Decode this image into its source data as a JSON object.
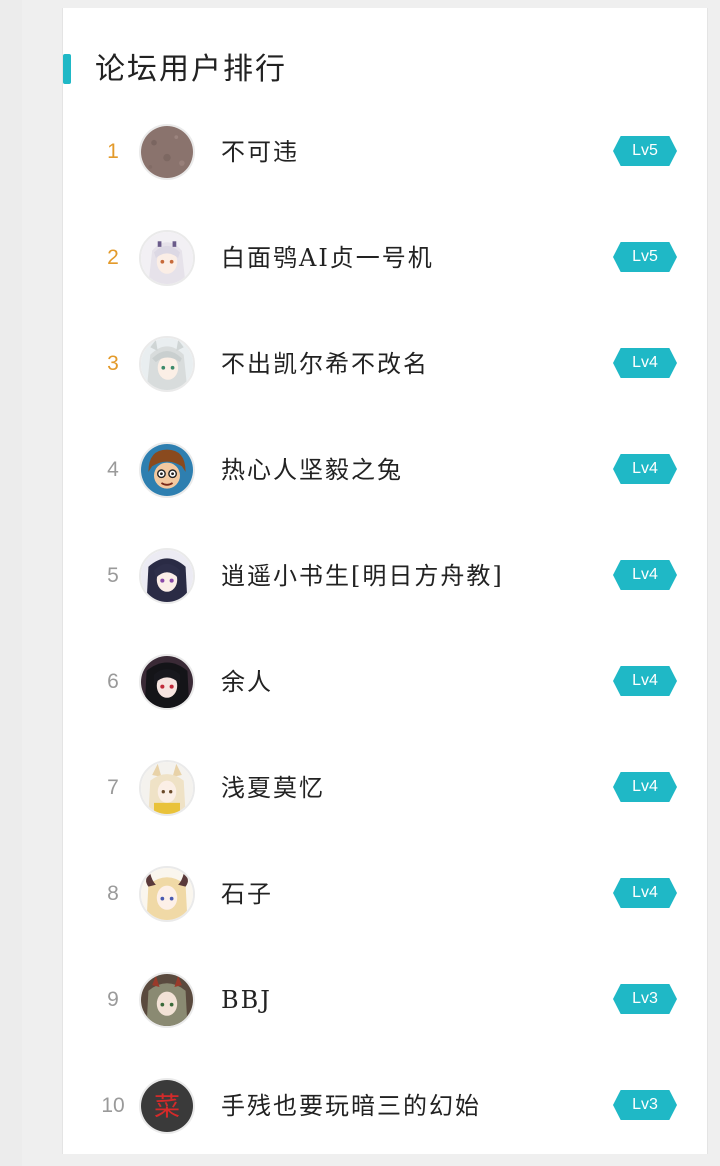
{
  "panel": {
    "title": "论坛用户排行"
  },
  "colors": {
    "accent": "#1fb8c6",
    "top_rank": "#e39a2a",
    "rank": "#9a9a9a"
  },
  "users": [
    {
      "rank": "1",
      "name": "不可违",
      "level": "Lv5",
      "avatar_icon": "avatar-brown-texture"
    },
    {
      "rank": "2",
      "name": "白面鸮AI贞一号机",
      "level": "Lv5",
      "avatar_icon": "avatar-anime-white-hair"
    },
    {
      "rank": "3",
      "name": "不出凯尔希不改名",
      "level": "Lv4",
      "avatar_icon": "avatar-anime-silver-hair"
    },
    {
      "rank": "4",
      "name": "热心人坚毅之兔",
      "level": "Lv4",
      "avatar_icon": "avatar-cartoon-boy"
    },
    {
      "rank": "5",
      "name": "逍遥小书生[明日方舟教]",
      "level": "Lv4",
      "avatar_icon": "avatar-anime-dark-hair"
    },
    {
      "rank": "6",
      "name": "余人",
      "level": "Lv4",
      "avatar_icon": "avatar-anime-black-hair"
    },
    {
      "rank": "7",
      "name": "浅夏莫忆",
      "level": "Lv4",
      "avatar_icon": "avatar-anime-fox-girl"
    },
    {
      "rank": "8",
      "name": "石子",
      "level": "Lv4",
      "avatar_icon": "avatar-anime-blonde-horns"
    },
    {
      "rank": "9",
      "name": "BBJ",
      "level": "Lv3",
      "avatar_icon": "avatar-anime-green-hair"
    },
    {
      "rank": "10",
      "name": "手残也要玩暗三的幻始",
      "level": "Lv3",
      "avatar_icon": "avatar-red-character",
      "avatar_glyph": "菜"
    }
  ]
}
